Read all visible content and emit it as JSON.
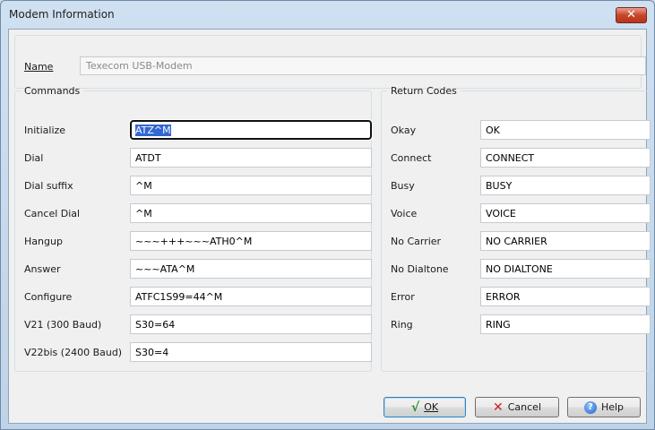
{
  "window": {
    "title": "Modem Information",
    "close_glyph": "✕"
  },
  "name_field": {
    "label": "Name",
    "value": "Texecom USB-Modem"
  },
  "commands": {
    "legend": "Commands",
    "rows": [
      {
        "label": "Initialize",
        "value": "ATZ^M"
      },
      {
        "label": "Dial",
        "value": "ATDT"
      },
      {
        "label": "Dial suffix",
        "value": "^M"
      },
      {
        "label": "Cancel Dial",
        "value": "^M"
      },
      {
        "label": "Hangup",
        "value": "~~~+++~~~ATH0^M"
      },
      {
        "label": "Answer",
        "value": "~~~ATA^M"
      },
      {
        "label": "Configure",
        "value": "ATFC1S99=44^M"
      },
      {
        "label": "V21 (300 Baud)",
        "value": "S30=64"
      },
      {
        "label": "V22bis (2400 Baud)",
        "value": "S30=4"
      }
    ]
  },
  "return_codes": {
    "legend": "Return Codes",
    "rows": [
      {
        "label": "Okay",
        "value": "OK"
      },
      {
        "label": "Connect",
        "value": "CONNECT"
      },
      {
        "label": "Busy",
        "value": "BUSY"
      },
      {
        "label": "Voice",
        "value": "VOICE"
      },
      {
        "label": "No Carrier",
        "value": "NO CARRIER"
      },
      {
        "label": "No Dialtone",
        "value": "NO DIALTONE"
      },
      {
        "label": "Error",
        "value": "ERROR"
      },
      {
        "label": "Ring",
        "value": "RING"
      }
    ]
  },
  "buttons": {
    "ok": {
      "label": "OK",
      "icon": "checkmark-icon",
      "glyph": "√"
    },
    "cancel": {
      "label": "Cancel",
      "icon": "cancel-x-icon",
      "glyph": "✕"
    },
    "help": {
      "label": "Help",
      "icon": "help-icon",
      "glyph": "?"
    }
  },
  "colors": {
    "selection": "#3399ff",
    "focus_border": "#5e9ed6",
    "ok_icon": "#2e8b2e",
    "cancel_icon": "#c8251b"
  }
}
